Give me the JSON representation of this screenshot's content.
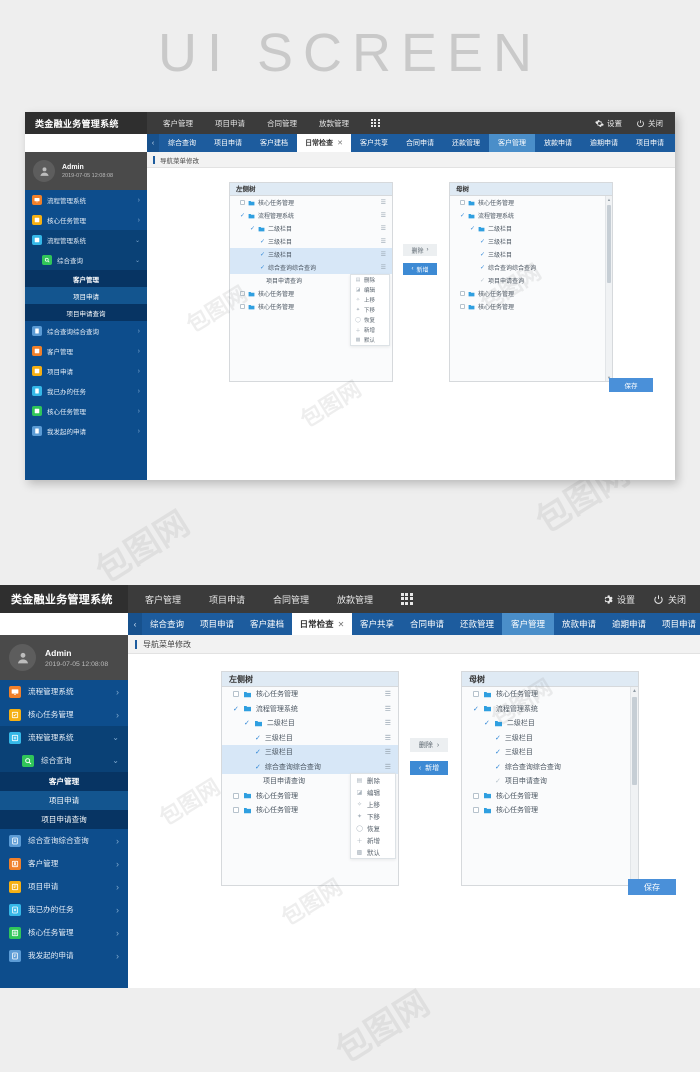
{
  "page": {
    "heading": "UI SCREEN",
    "watermark": "包图网"
  },
  "app": {
    "brand": "类金融业务管理系统",
    "topmenu": [
      {
        "label": "客户管理"
      },
      {
        "label": "项目申请"
      },
      {
        "label": "合同管理"
      },
      {
        "label": "放款管理"
      }
    ],
    "grid_icon": "grid-apps-icon",
    "topright": [
      {
        "icon": "gear-icon",
        "label": "设置"
      },
      {
        "icon": "power-icon",
        "label": "关闭"
      }
    ]
  },
  "tabs": {
    "arrow_left": "‹",
    "arrow_right": "›",
    "items": [
      {
        "label": "综合查询",
        "state": "normal",
        "closable": false
      },
      {
        "label": "项目申请",
        "state": "normal",
        "closable": false
      },
      {
        "label": "客户建档",
        "state": "normal",
        "closable": false
      },
      {
        "label": "日常检查",
        "state": "active",
        "closable": true,
        "close": "✕"
      },
      {
        "label": "客户共享",
        "state": "normal",
        "closable": false
      },
      {
        "label": "合同申请",
        "state": "normal",
        "closable": false
      },
      {
        "label": "还款管理",
        "state": "normal",
        "closable": false
      },
      {
        "label": "客户管理",
        "state": "highlight",
        "closable": false
      },
      {
        "label": "放款申请",
        "state": "normal",
        "closable": false
      },
      {
        "label": "逾期申请",
        "state": "normal",
        "closable": false
      },
      {
        "label": "项目申请",
        "state": "normal",
        "closable": false
      }
    ]
  },
  "user": {
    "name": "Admin",
    "time": "2019-07-05 12:08:08",
    "avatar": "user-avatar-icon"
  },
  "sidebar": {
    "items": [
      {
        "label": "流程管理系统",
        "icon": "monitor-icon",
        "color": "#f0802a",
        "level": 0,
        "state": "normal",
        "chevron": "›"
      },
      {
        "label": "核心任务管理",
        "icon": "tasks-icon",
        "color": "#f5b014",
        "level": 0,
        "state": "normal",
        "chevron": "›"
      },
      {
        "label": "流程管理系统",
        "icon": "flow-icon",
        "color": "#35b8e8",
        "level": 0,
        "state": "open",
        "chevron": "⌄"
      },
      {
        "label": "综合查询",
        "icon": "search-db-icon",
        "color": "#30c659",
        "level": 1,
        "state": "open",
        "chevron": "⌄"
      },
      {
        "label": "客户管理",
        "icon": "",
        "color": "",
        "level": 2,
        "state": "leaf-dark",
        "chevron": ""
      },
      {
        "label": "项目申请",
        "icon": "",
        "color": "",
        "level": 2,
        "state": "leaf-sel",
        "chevron": ""
      },
      {
        "label": "项目申请查询",
        "icon": "",
        "color": "",
        "level": 2,
        "state": "leaf-dark",
        "chevron": ""
      },
      {
        "label": "综合查询综合查询",
        "icon": "doc-icon",
        "color": "#5b9bd5",
        "level": 0,
        "state": "normal",
        "chevron": "›"
      },
      {
        "label": "客户管理",
        "icon": "customer-icon",
        "color": "#f0802a",
        "level": 0,
        "state": "normal",
        "chevron": "›"
      },
      {
        "label": "项目申请",
        "icon": "apply-icon",
        "color": "#f5b014",
        "level": 0,
        "state": "normal",
        "chevron": "›"
      },
      {
        "label": "我已办的任务",
        "icon": "done-icon",
        "color": "#35b8e8",
        "level": 0,
        "state": "normal",
        "chevron": "›"
      },
      {
        "label": "核心任务管理",
        "icon": "core-icon",
        "color": "#30c659",
        "level": 0,
        "state": "normal",
        "chevron": "›"
      },
      {
        "label": "我发起的申请",
        "icon": "start-icon",
        "color": "#5b9bd5",
        "level": 0,
        "state": "normal",
        "chevron": "›"
      }
    ]
  },
  "breadcrumb": {
    "label": "导航菜单修改"
  },
  "left_tree": {
    "title": "左侧树",
    "menu_icon": "row-menu-icon",
    "rows": [
      {
        "label": "核心任务管理",
        "indent": 0,
        "mark": "checkbox",
        "folder": true,
        "selected": false,
        "menu": true
      },
      {
        "label": "流程管理系统",
        "indent": 0,
        "mark": "check",
        "folder": true,
        "selected": false,
        "menu": true
      },
      {
        "label": "二级栏目",
        "indent": 1,
        "mark": "check",
        "folder": true,
        "selected": false,
        "menu": true
      },
      {
        "label": "三级栏目",
        "indent": 2,
        "mark": "check",
        "folder": false,
        "selected": false,
        "menu": true
      },
      {
        "label": "三级栏目",
        "indent": 2,
        "mark": "check",
        "folder": false,
        "selected": true,
        "menu": true
      },
      {
        "label": "综合查询综合查询",
        "indent": 2,
        "mark": "check",
        "folder": false,
        "selected": true,
        "menu": true
      },
      {
        "label": "项目申请查询",
        "indent": 2,
        "mark": "none",
        "folder": false,
        "selected": false,
        "menu": false
      },
      {
        "label": "核心任务管理",
        "indent": 0,
        "mark": "checkbox",
        "folder": true,
        "selected": false,
        "menu": false
      },
      {
        "label": "核心任务管理",
        "indent": 0,
        "mark": "checkbox",
        "folder": true,
        "selected": false,
        "menu": false
      }
    ]
  },
  "context_menu": {
    "items": [
      {
        "label": "删除",
        "icon": "trash-icon",
        "glyph": "▤"
      },
      {
        "label": "编辑",
        "icon": "edit-icon",
        "glyph": "◪"
      },
      {
        "label": "上移",
        "icon": "arrow-up-icon",
        "glyph": "✧"
      },
      {
        "label": "下移",
        "icon": "arrow-down-icon",
        "glyph": "✦"
      },
      {
        "label": "恢复",
        "icon": "restore-icon",
        "glyph": "◯"
      },
      {
        "label": "新增",
        "icon": "plus-icon",
        "glyph": "＋"
      },
      {
        "label": "默认",
        "icon": "default-icon",
        "glyph": "▩"
      }
    ]
  },
  "mid_buttons": [
    {
      "label": "删除",
      "style": "gray",
      "arrow": "›",
      "arrow_pos": "right"
    },
    {
      "label": "新增",
      "style": "blue",
      "arrow": "‹",
      "arrow_pos": "left"
    }
  ],
  "right_tree": {
    "title": "母树",
    "rows": [
      {
        "label": "核心任务管理",
        "indent": 0,
        "mark": "checkbox",
        "folder": true
      },
      {
        "label": "流程管理系统",
        "indent": 0,
        "mark": "check",
        "folder": true
      },
      {
        "label": "二级栏目",
        "indent": 1,
        "mark": "check",
        "folder": true
      },
      {
        "label": "三级栏目",
        "indent": 2,
        "mark": "check",
        "folder": false
      },
      {
        "label": "三级栏目",
        "indent": 2,
        "mark": "check",
        "folder": false
      },
      {
        "label": "综合查询综合查询",
        "indent": 2,
        "mark": "check",
        "folder": false
      },
      {
        "label": "项目申请查询",
        "indent": 2,
        "mark": "check-gray",
        "folder": false
      },
      {
        "label": "核心任务管理",
        "indent": 0,
        "mark": "checkbox",
        "folder": true
      },
      {
        "label": "核心任务管理",
        "indent": 0,
        "mark": "checkbox",
        "folder": true
      }
    ],
    "scrollbar": {
      "up_arrow": "▲",
      "down_arrow": "▼"
    }
  },
  "save_button": {
    "label": "保存"
  },
  "colors": {
    "brand_dark": "#2f2f2f",
    "topbar": "#3b3b3b",
    "tab_blue": "#1d5c9e",
    "tab_highlight": "#4a8ec9",
    "sidebar": "#0d4d8c",
    "sidebar_open": "#0a4176",
    "accent": "#4a90d9",
    "tree_header": "#dfeaf4",
    "tree_selected": "#d7e7f7"
  }
}
